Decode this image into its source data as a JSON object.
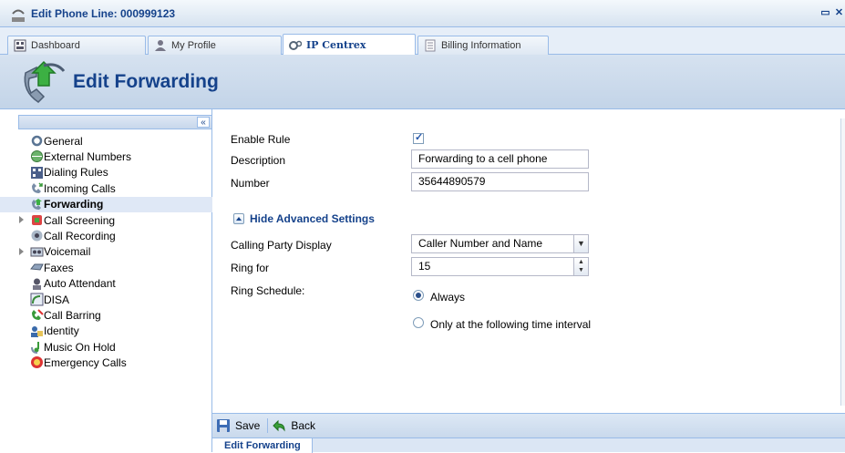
{
  "window": {
    "title": "Edit Phone Line: 000999123"
  },
  "tabs": [
    {
      "label": "Dashboard"
    },
    {
      "label": "My Profile"
    },
    {
      "label": "IP Centrex"
    },
    {
      "label": "Billing Information"
    }
  ],
  "header": {
    "title": "Edit Forwarding"
  },
  "sidebar": {
    "items": [
      {
        "label": "General"
      },
      {
        "label": "External Numbers"
      },
      {
        "label": "Dialing Rules"
      },
      {
        "label": "Incoming Calls"
      },
      {
        "label": "Forwarding"
      },
      {
        "label": "Call Screening"
      },
      {
        "label": "Call Recording"
      },
      {
        "label": "Voicemail"
      },
      {
        "label": "Faxes"
      },
      {
        "label": "Auto Attendant"
      },
      {
        "label": "DISA"
      },
      {
        "label": "Call Barring"
      },
      {
        "label": "Identity"
      },
      {
        "label": "Music On Hold"
      },
      {
        "label": "Emergency Calls"
      }
    ],
    "selected": "Forwarding"
  },
  "form": {
    "enable_rule_label": "Enable Rule",
    "enable_rule_checked": true,
    "description_label": "Description",
    "description_value": "Forwarding to a cell phone",
    "number_label": "Number",
    "number_value": "35644890579",
    "advanced_toggle": "Hide Advanced Settings",
    "calling_party_label": "Calling Party Display",
    "calling_party_value": "Caller Number and Name",
    "ring_for_label": "Ring for",
    "ring_for_value": "15",
    "ring_schedule_label": "Ring Schedule:",
    "ring_schedule_option_always": "Always",
    "ring_schedule_option_interval": "Only at the following time interval",
    "ring_schedule_selected": "Always"
  },
  "toolbar": {
    "save_label": "Save",
    "back_label": "Back"
  },
  "footer": {
    "tab_label": "Edit Forwarding"
  }
}
